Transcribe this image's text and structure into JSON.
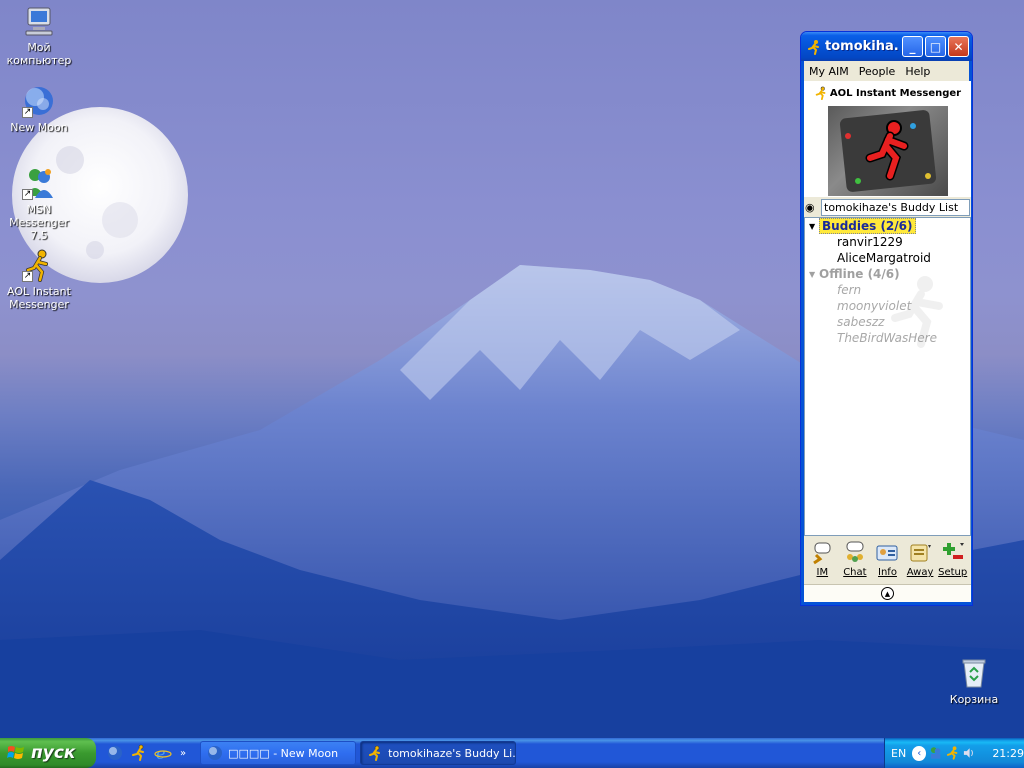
{
  "desktop": {
    "icons": [
      {
        "label": "Мой компьютер",
        "icon": "my-computer-icon"
      },
      {
        "label": "New Moon",
        "icon": "new-moon-browser-icon"
      },
      {
        "label": "MSN Messenger 7.5",
        "icon": "msn-messenger-icon"
      },
      {
        "label": "AOL Instant Messenger",
        "icon": "aim-icon"
      },
      {
        "label": "Корзина",
        "icon": "recycle-bin-icon"
      }
    ]
  },
  "aim": {
    "title": "tomokiha...",
    "menu": [
      "My AIM",
      "People",
      "Help"
    ],
    "brand": "AOL Instant Messenger",
    "buddylist_name": "tomokihaze's Buddy List",
    "groups": [
      {
        "label": "Buddies (2/6)",
        "state": "online",
        "buddies": [
          "ranvir1229",
          "AliceMargatroid"
        ]
      },
      {
        "label": "Offline (4/6)",
        "state": "offline",
        "buddies": [
          "fern",
          "moonyviolet",
          "sabeszz",
          "TheBirdWasHere"
        ]
      }
    ],
    "toolbar": [
      "IM",
      "Chat",
      "Info",
      "Away",
      "Setup"
    ]
  },
  "taskbar": {
    "start_label": "пуск",
    "tasks": [
      {
        "label": "□□□□ - New Moon",
        "icon": "new-moon-browser-icon",
        "state": "inactive"
      },
      {
        "label": "tomokihaze's Buddy Li...",
        "icon": "aim-icon",
        "state": "active"
      }
    ],
    "tray": {
      "language": "EN",
      "clock": "21:29"
    }
  },
  "colors": {
    "xp_blue": "#0553d6",
    "start_green": "#3a9a2f",
    "aim_yellow": "#ffe93b"
  }
}
